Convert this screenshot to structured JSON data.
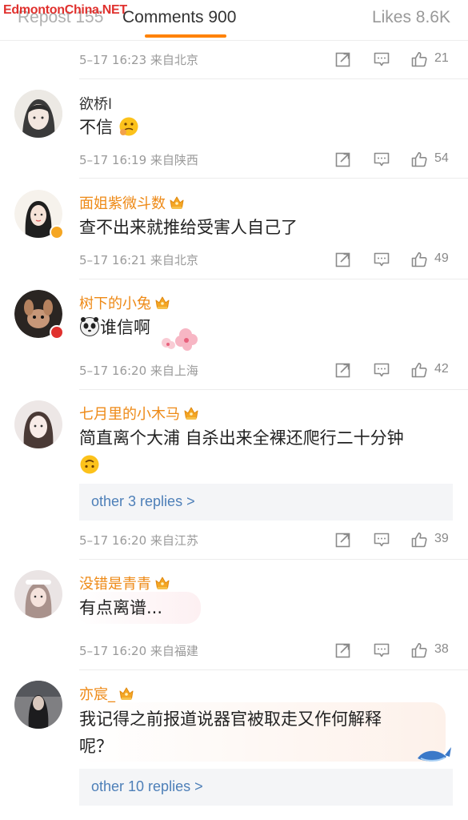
{
  "watermark": "EdmontonChina.NET",
  "tabs": {
    "repost": "Repost 155",
    "comments": "Comments 900",
    "likes": "Likes 8.6K"
  },
  "colors": {
    "accent": "#ff8200",
    "vip_name": "#ee8a17",
    "link": "#4d7fb8",
    "meta": "#9a9a9a"
  },
  "top_meta": {
    "meta": "5–17 16:23  来自北京",
    "likes": "21"
  },
  "comments": [
    {
      "user": "欲桥l",
      "vip": false,
      "content": "不信",
      "meta": "5–17 16:19  来自陕西",
      "likes": "54"
    },
    {
      "user": "面姐紫微斗数",
      "vip": true,
      "content": "查不出来就推给受害人自己了",
      "meta": "5–17 16:21  来自北京",
      "likes": "49"
    },
    {
      "user": "树下的小兔",
      "vip": true,
      "content": "谁信啊",
      "meta": "5–17 16:20  来自上海",
      "likes": "42"
    },
    {
      "user": "七月里的小木马",
      "vip": true,
      "content_line1": "简直离个大浦 自杀出来全裸还爬行二十分钟",
      "replies": "other 3 replies >",
      "meta": "5–17 16:20  来自江苏",
      "likes": "39"
    },
    {
      "user": "没错是青青",
      "vip": true,
      "content": "有点离谱...",
      "meta": "5–17 16:20  来自福建",
      "likes": "38"
    },
    {
      "user": "亦宸_",
      "vip": true,
      "content_line1": "我记得之前报道说器官被取走又作何解释",
      "content_line2": "呢？",
      "replies": "other 10 replies >"
    }
  ]
}
